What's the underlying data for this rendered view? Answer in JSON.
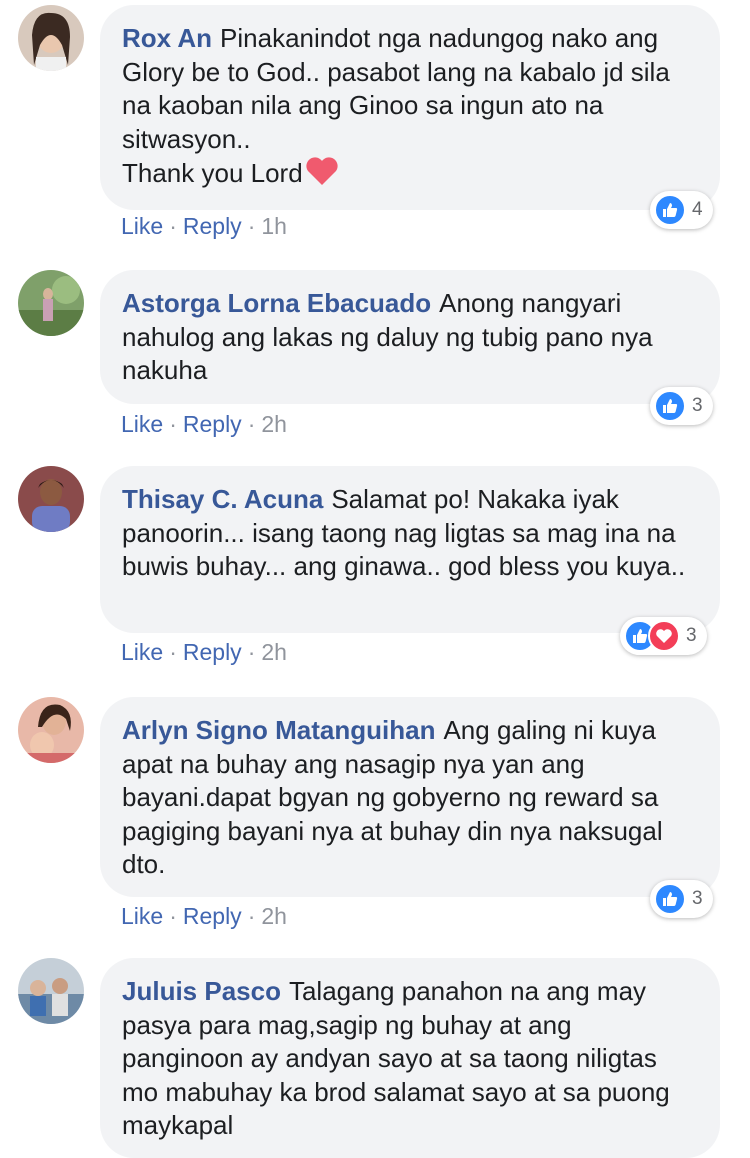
{
  "comments": [
    {
      "author": "Rox An",
      "text": "Pinakanindot nga nadungog nako ang Glory be to God.. pasabot lang na kabalo jd sila na kaoban nila ang Ginoo sa ingun ato na sitwasyon..",
      "text2": "Thank you Lord",
      "like": "Like",
      "reply": "Reply",
      "time": "1h",
      "reactions": "4",
      "reaction_icons": [
        "like-icon"
      ]
    },
    {
      "author": "Astorga Lorna Ebacuado",
      "text": "Anong nangyari nahulog ang lakas ng daluy ng tubig pano nya nakuha",
      "like": "Like",
      "reply": "Reply",
      "time": "2h",
      "reactions": "3",
      "reaction_icons": [
        "like-icon"
      ]
    },
    {
      "author": "Thisay C. Acuna",
      "text": "Salamat po! Nakaka iyak panoorin... isang taong nag ligtas sa mag ina na buwis buhay... ang ginawa.. god bless you kuya..",
      "like": "Like",
      "reply": "Reply",
      "time": "2h",
      "reactions": "3",
      "reaction_icons": [
        "like-icon",
        "love-icon"
      ]
    },
    {
      "author": "Arlyn Signo Matanguihan",
      "text": "Ang galing ni kuya apat na buhay ang nasagip nya yan ang bayani.dapat bgyan ng gobyerno ng reward sa pagiging bayani nya at buhay din nya naksugal dto.",
      "like": "Like",
      "reply": "Reply",
      "time": "2h",
      "reactions": "3",
      "reaction_icons": [
        "like-icon"
      ]
    },
    {
      "author": "Juluis Pasco",
      "text": "Talagang panahon na ang may pasya para mag,sagip ng buhay at ang panginoon ay andyan sayo at sa taong niligtas mo mabuhay ka brod salamat sayo at sa puong maykapal"
    }
  ],
  "separator": "·",
  "colors": {
    "name": "#385898",
    "link": "#4267b2",
    "bubble": "#f2f3f5",
    "like": "#2d88ff",
    "love": "#f33e58"
  }
}
